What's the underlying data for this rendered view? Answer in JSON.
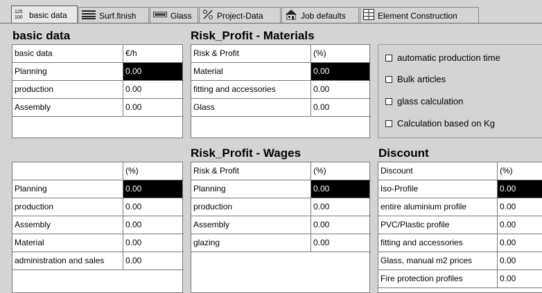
{
  "tabs": [
    {
      "label": "basic data",
      "icon": "counter-icon",
      "active": true
    },
    {
      "label": "Surf.finish",
      "icon": "stripes-icon"
    },
    {
      "label": "Glass",
      "icon": "glass-pane-icon"
    },
    {
      "label": "Project-Data",
      "icon": "percent-icon"
    },
    {
      "label": "Job defaults",
      "icon": "house-icon"
    },
    {
      "label": "Element Construction",
      "icon": "window-grid-icon"
    }
  ],
  "basic_data": {
    "title": "basic data",
    "header": [
      "basic data",
      "€/h"
    ],
    "rows": [
      {
        "label": "Planning",
        "value": "0.00"
      },
      {
        "label": "production",
        "value": "0.00"
      },
      {
        "label": "Assembly",
        "value": "0.00"
      }
    ]
  },
  "risk_materials": {
    "title": "Risk_Profit - Materials",
    "header": [
      "Risk & Profit",
      "(%)"
    ],
    "rows": [
      {
        "label": "Material",
        "value": "0.00"
      },
      {
        "label": "fitting and accessories",
        "value": "0.00"
      },
      {
        "label": "Glass",
        "value": "0.00"
      }
    ]
  },
  "options": [
    "automatic production time",
    "Bulk articles",
    "glass calculation",
    "Calculation based on Kg"
  ],
  "percent_table": {
    "header": [
      "",
      "(%)"
    ],
    "rows": [
      {
        "label": "Planning",
        "value": "0.00"
      },
      {
        "label": "production",
        "value": "0.00"
      },
      {
        "label": "Assembly",
        "value": "0.00"
      },
      {
        "label": "Material",
        "value": "0.00"
      },
      {
        "label": "administration and sales",
        "value": "0.00"
      }
    ]
  },
  "risk_wages": {
    "title": "Risk_Profit - Wages",
    "header": [
      "Risk & Profit",
      "(%)"
    ],
    "rows": [
      {
        "label": "Planning",
        "value": "0.00"
      },
      {
        "label": "production",
        "value": "0.00"
      },
      {
        "label": "Assembly",
        "value": "0.00"
      },
      {
        "label": "glazing",
        "value": "0.00"
      }
    ]
  },
  "discount": {
    "title": "Discount",
    "header": [
      "Discount",
      "(%)"
    ],
    "rows": [
      {
        "label": "Iso-Profile",
        "value": "0.00"
      },
      {
        "label": "entire aluminium profile",
        "value": "0.00"
      },
      {
        "label": "PVC/Plastic profile",
        "value": "0.00"
      },
      {
        "label": "fitting and accessories",
        "value": "0.00"
      },
      {
        "label": "Glass, manual m2 prices",
        "value": "0.00"
      },
      {
        "label": "Fire protection profiles",
        "value": "0.00"
      }
    ]
  }
}
